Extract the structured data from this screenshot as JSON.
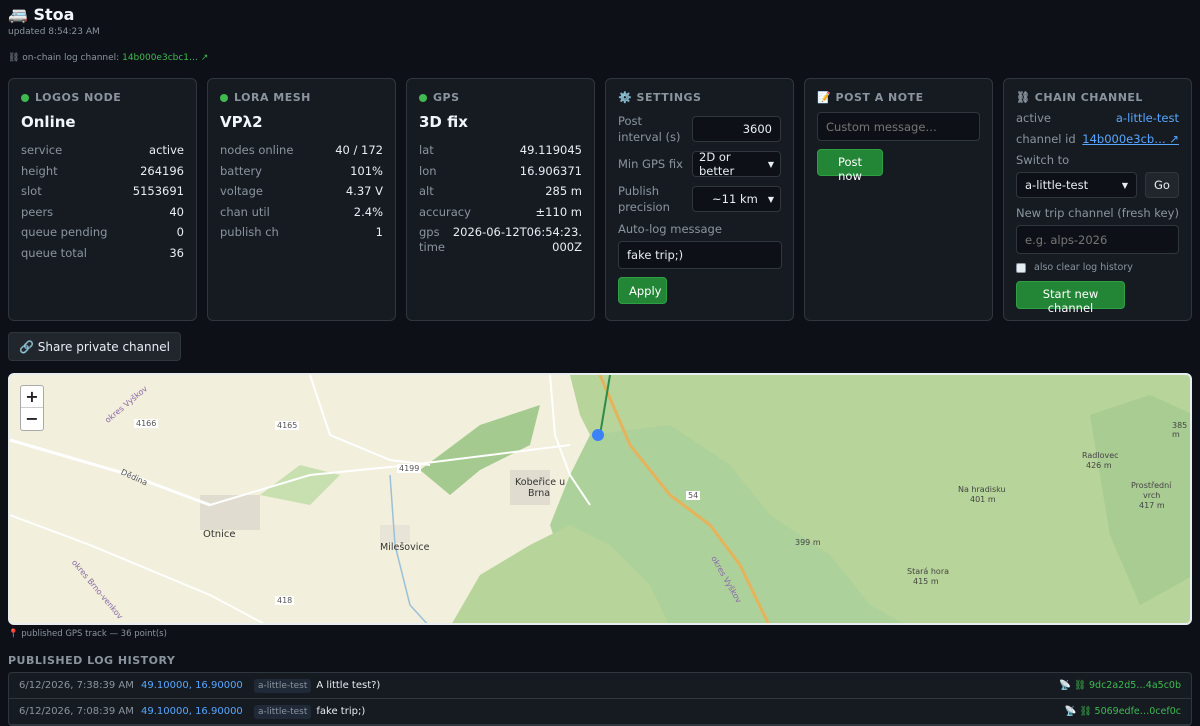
{
  "header": {
    "title": "🚐 Stoa",
    "updated": "updated 8:54:23 AM"
  },
  "chain_line": {
    "label": "⛓ on-chain log channel:",
    "hash": "14b000e3cbc1… ↗"
  },
  "logos": {
    "title": "LOGOS NODE",
    "status": "Online",
    "rows": [
      {
        "k": "service",
        "v": "active"
      },
      {
        "k": "height",
        "v": "264196"
      },
      {
        "k": "slot",
        "v": "5153691"
      },
      {
        "k": "peers",
        "v": "40"
      },
      {
        "k": "queue pending",
        "v": "0"
      },
      {
        "k": "queue total",
        "v": "36"
      }
    ]
  },
  "lora": {
    "title": "LORA MESH",
    "status": "VPλ2",
    "rows": [
      {
        "k": "nodes online",
        "v": "40 / 172"
      },
      {
        "k": "battery",
        "v": "101%"
      },
      {
        "k": "voltage",
        "v": "4.37 V"
      },
      {
        "k": "chan util",
        "v": "2.4%"
      },
      {
        "k": "publish ch",
        "v": "1"
      }
    ]
  },
  "gps": {
    "title": "GPS",
    "status": "3D fix",
    "rows": [
      {
        "k": "lat",
        "v": "49.119045"
      },
      {
        "k": "lon",
        "v": "16.906371"
      },
      {
        "k": "alt",
        "v": "285 m"
      },
      {
        "k": "accuracy",
        "v": "±110 m"
      }
    ],
    "time_k1": "gps",
    "time_k2": "time",
    "time_v1": "2026-06-12T06:54:23.",
    "time_v2": "000Z"
  },
  "settings": {
    "title": "⚙️ SETTINGS",
    "post_interval_label": "Post interval (s)",
    "post_interval_value": "3600",
    "min_fix_label": "Min GPS fix",
    "min_fix_value": "2D or better",
    "precision_label": "Publish precision",
    "precision_value": "~11 km",
    "autolog_label": "Auto-log message",
    "autolog_value": "fake trip;)",
    "apply": "Apply"
  },
  "note": {
    "title": "📝 POST A NOTE",
    "placeholder": "Custom message…",
    "post": "Post now"
  },
  "chain": {
    "title": "⛓ CHAIN CHANNEL",
    "active_k": "active",
    "active_v": "a-little-test",
    "id_k": "channel id",
    "id_v": "14b000e3cb… ↗",
    "switch_label": "Switch to",
    "switch_value": "a-little-test",
    "go": "Go",
    "new_label": "New trip channel (fresh key)",
    "new_placeholder": "e.g. alps-2026",
    "clear_label": "also clear log history",
    "start": "Start new channel"
  },
  "share": {
    "label": "🔗 Share private channel"
  },
  "map": {
    "zoom_in": "+",
    "zoom_out": "−",
    "labels": {
      "r4166": "4166",
      "r4165": "4165",
      "r4199": "4199",
      "r54": "54",
      "r418": "418",
      "otnice": "Otnice",
      "kobe": "Kobeřice u",
      "kobe2": "Brna",
      "mile": "Milešovice",
      "dedina": "Dědina",
      "okres": "okres Vyškov",
      "okres2": "okres Brno-venkov",
      "nahrad": "Na hradisku",
      "nahrad2": "401 m",
      "stara": "Stará hora",
      "stara2": "415 m",
      "radl": "Radlovec",
      "radl2": "426 m",
      "pros": "Prostřední",
      "pros2": "vrch",
      "pros3": "417 m",
      "h399": "399 m",
      "h385": "385 m",
      "okres3": "okres Vyškov"
    }
  },
  "caption": "📍 published GPS track — 36 point(s)",
  "history": {
    "title": "PUBLISHED LOG HISTORY",
    "rows": [
      {
        "ts": "6/12/2026, 7:38:39 AM",
        "coords": "49.10000, 16.90000",
        "tag": "a-little-test",
        "msg": "A little test?)",
        "tx": "📡 ⛓ 9dc2a2d5…4a5c0b"
      },
      {
        "ts": "6/12/2026, 7:08:39 AM",
        "coords": "49.10000, 16.90000",
        "tag": "a-little-test",
        "msg": "fake trip;)",
        "tx": "📡 ⛓ 5069edfe…0cef0c"
      }
    ]
  },
  "colors": {
    "accent_green": "#238636",
    "status_dot": "#3fb950",
    "link": "#58a6ff",
    "bg": "#0d1117"
  }
}
